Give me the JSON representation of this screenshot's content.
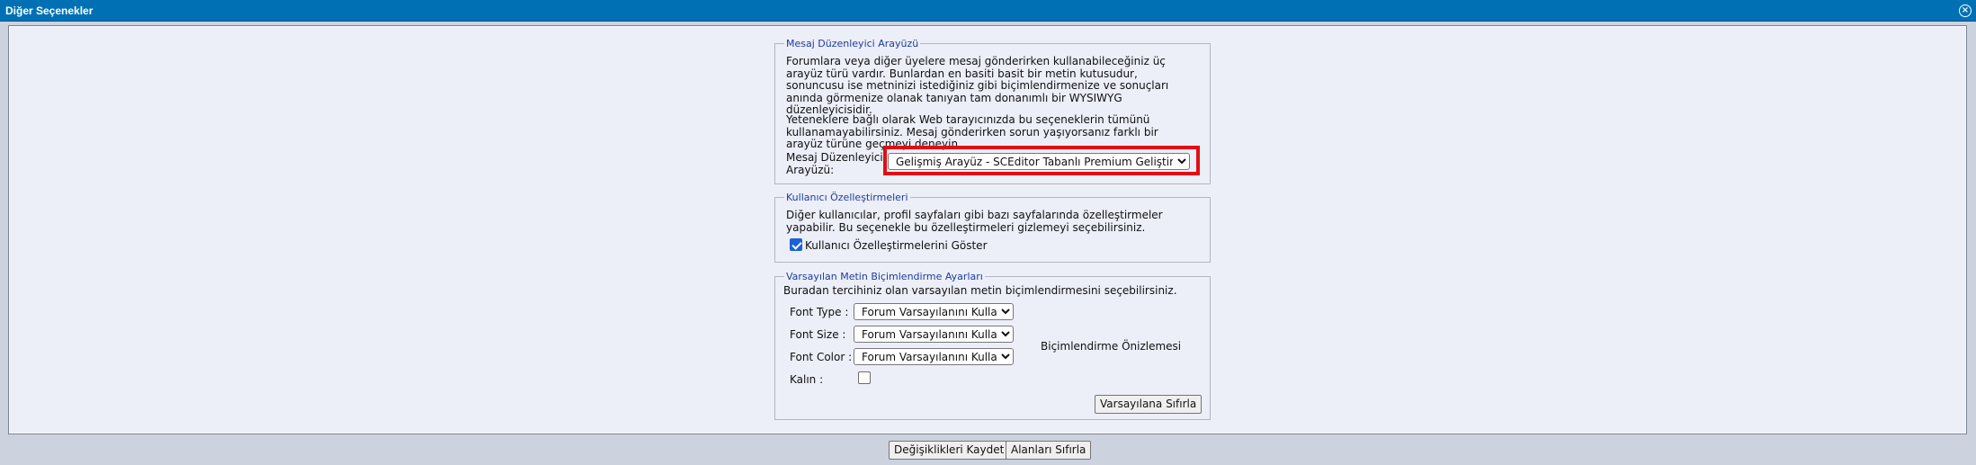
{
  "window": {
    "title": "Diğer Seçenekler",
    "close_glyph": "×"
  },
  "editor_section": {
    "legend": "Mesaj Düzenleyici Arayüzü",
    "description_1": "Forumlara veya diğer üyelere mesaj gönderirken kullanabileceğiniz üç arayüz türü vardır. Bunlardan en basiti basit bir metin kutusudur, sonuncusu ise metninizi istediğiniz gibi biçimlendirmenize ve sonuçları anında görmenize olanak tanıyan tam donanımlı bir WYSIWYG düzenleyicisidir.",
    "description_2": "Yeteneklere bağlı olarak Web tarayıcınızda bu seçeneklerin tümünü kullanamayabilirsiniz. Mesaj gönderirken sorun yaşıyorsanız farklı bir arayüz türüne geçmeyi deneyin.",
    "field_label": "Mesaj Düzenleyici Arayüzü:",
    "selected_value": "Gelişmiş Arayüz - SCEditor Tabanlı Premium Geliştirme"
  },
  "custom_section": {
    "legend": "Kullanıcı Özelleştirmeleri",
    "description": "Diğer kullanıcılar, profil sayfaları gibi bazı sayfalarında özelleştirmeler yapabilir. Bu seçenekle bu özelleştirmeleri gizlemeyi seçebilirsiniz.",
    "checkbox_label": "Kullanıcı Özelleştirmelerini Göster",
    "checked": true
  },
  "format_section": {
    "legend": "Varsayılan Metin Biçimlendirme Ayarları",
    "description": "Buradan tercihiniz olan varsayılan metin biçimlendirmesini seçebilirsiniz.",
    "font_type_label": "Font Type :",
    "font_size_label": "Font Size :",
    "font_color_label": "Font Color :",
    "bold_label": "Kalın :",
    "font_type_value": "Forum Varsayılanını Kullan",
    "font_size_value": "Forum Varsayılanını Kullan",
    "font_color_value": "Forum Varsayılanını Kullan",
    "preview_text": "Biçimlendirme Önizlemesi",
    "reset_button": "Varsayılana Sıfırla",
    "bold_checked": false
  },
  "footer": {
    "save_button": "Değişiklikleri Kaydet",
    "reset_button": "Alanları Sıfırla"
  },
  "colors": {
    "titlebar": "#0070b5",
    "legend_text": "#1d3d9c",
    "highlight_border": "#e10e14",
    "checkbox_checked": "#1a62d6"
  }
}
